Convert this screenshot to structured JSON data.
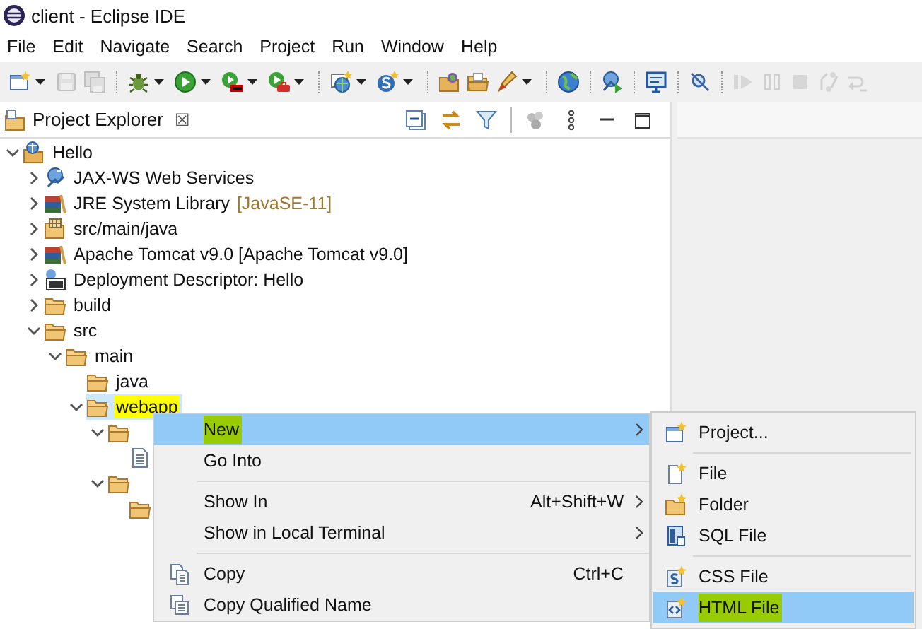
{
  "window": {
    "title": "client - Eclipse IDE"
  },
  "menu_bar": [
    "File",
    "Edit",
    "Navigate",
    "Search",
    "Project",
    "Run",
    "Window",
    "Help"
  ],
  "toolbar": [
    {
      "kind": "new",
      "dropdown": true,
      "disabled": false
    },
    {
      "kind": "save",
      "dropdown": false,
      "disabled": true
    },
    {
      "kind": "saveall",
      "dropdown": false,
      "disabled": true
    },
    {
      "kind": "sep"
    },
    {
      "kind": "debug",
      "dropdown": true,
      "disabled": false
    },
    {
      "kind": "run",
      "dropdown": true,
      "disabled": false
    },
    {
      "kind": "coverage",
      "dropdown": true,
      "disabled": false
    },
    {
      "kind": "external",
      "dropdown": true,
      "disabled": false
    },
    {
      "kind": "sep"
    },
    {
      "kind": "newserver",
      "dropdown": true,
      "disabled": false
    },
    {
      "kind": "newservice",
      "dropdown": true,
      "disabled": false
    },
    {
      "kind": "sep"
    },
    {
      "kind": "openproject",
      "dropdown": false,
      "disabled": false
    },
    {
      "kind": "openfolder",
      "dropdown": false,
      "disabled": false
    },
    {
      "kind": "pen",
      "dropdown": true,
      "disabled": false
    },
    {
      "kind": "sep"
    },
    {
      "kind": "globe",
      "dropdown": false,
      "disabled": false
    },
    {
      "kind": "sep"
    },
    {
      "kind": "deploy",
      "dropdown": false,
      "disabled": false
    },
    {
      "kind": "sep"
    },
    {
      "kind": "monitor",
      "dropdown": false,
      "disabled": false
    },
    {
      "kind": "sep"
    },
    {
      "kind": "skip",
      "dropdown": false,
      "disabled": false
    },
    {
      "kind": "sep"
    },
    {
      "kind": "resume",
      "dropdown": false,
      "disabled": true
    },
    {
      "kind": "suspend",
      "dropdown": false,
      "disabled": true
    },
    {
      "kind": "stop",
      "dropdown": false,
      "disabled": true
    },
    {
      "kind": "disconnect",
      "dropdown": false,
      "disabled": true
    },
    {
      "kind": "stepinto",
      "dropdown": false,
      "disabled": true
    }
  ],
  "view": {
    "title": "Project Explorer",
    "close": "☒"
  },
  "tree": [
    {
      "label": "Hello",
      "kind": "project",
      "expanded": true,
      "selected": false,
      "highlighted": false,
      "children": [
        {
          "label": "JAX-WS Web Services",
          "kind": "webservices",
          "expanded": false,
          "selected": false,
          "highlighted": false
        },
        {
          "label": "JRE System Library",
          "decoration": "[JavaSE-11]",
          "kind": "library",
          "expanded": false,
          "selected": false,
          "highlighted": false
        },
        {
          "label": "src/main/java",
          "kind": "srcfolder",
          "expanded": false,
          "selected": false,
          "highlighted": false
        },
        {
          "label": "Apache Tomcat v9.0 [Apache Tomcat v9.0]",
          "kind": "library",
          "expanded": false,
          "selected": false,
          "highlighted": false
        },
        {
          "label": "Deployment Descriptor: Hello",
          "kind": "deployment",
          "expanded": false,
          "selected": false,
          "highlighted": false
        },
        {
          "label": "build",
          "kind": "folder",
          "expanded": false,
          "selected": false,
          "highlighted": false
        },
        {
          "label": "src",
          "kind": "folder",
          "expanded": true,
          "selected": false,
          "highlighted": false,
          "children": [
            {
              "label": "main",
              "kind": "folder",
              "expanded": true,
              "selected": false,
              "highlighted": false,
              "children": [
                {
                  "label": "java",
                  "kind": "folder",
                  "selected": false,
                  "highlighted": false
                },
                {
                  "label": "webapp",
                  "kind": "folder",
                  "expanded": true,
                  "selected": true,
                  "highlighted": true,
                  "children": [
                    {
                      "kind": "folder",
                      "expanded": true,
                      "selected": false,
                      "children": [
                        {
                          "kind": "file",
                          "selected": false
                        }
                      ]
                    },
                    {
                      "kind": "folder",
                      "expanded": true,
                      "selected": false,
                      "children": [
                        {
                          "kind": "folder",
                          "selected": false
                        }
                      ]
                    }
                  ]
                }
              ]
            }
          ]
        }
      ]
    }
  ],
  "context_menu": [
    {
      "kind": "plain",
      "label": "New",
      "submenu": true,
      "selected": true,
      "highlighted": true
    },
    {
      "kind": "plain",
      "label": "Go Into",
      "selected": false,
      "highlighted": false
    },
    {
      "kind": "separator"
    },
    {
      "kind": "plain",
      "label": "Show In",
      "shortcut": "Alt+Shift+W",
      "submenu": true,
      "selected": false,
      "highlighted": false
    },
    {
      "kind": "plain",
      "label": "Show in Local Terminal",
      "submenu": true,
      "selected": false,
      "highlighted": false
    },
    {
      "kind": "separator"
    },
    {
      "kind": "copy",
      "label": "Copy",
      "shortcut": "Ctrl+C",
      "selected": false,
      "highlighted": false
    },
    {
      "kind": "copyname",
      "label": "Copy Qualified Name",
      "selected": false,
      "highlighted": false
    }
  ],
  "submenu": [
    {
      "kind": "project",
      "label": "Project...",
      "selected": false,
      "highlighted": false
    },
    {
      "kind": "separator"
    },
    {
      "kind": "file",
      "label": "File",
      "selected": false,
      "highlighted": false
    },
    {
      "kind": "folder",
      "label": "Folder",
      "selected": false,
      "highlighted": false
    },
    {
      "kind": "sql",
      "label": "SQL File",
      "selected": false,
      "highlighted": false
    },
    {
      "kind": "separator"
    },
    {
      "kind": "css",
      "label": "CSS File",
      "selected": false,
      "highlighted": false
    },
    {
      "kind": "html",
      "label": "HTML File",
      "selected": true,
      "highlighted": true
    }
  ]
}
